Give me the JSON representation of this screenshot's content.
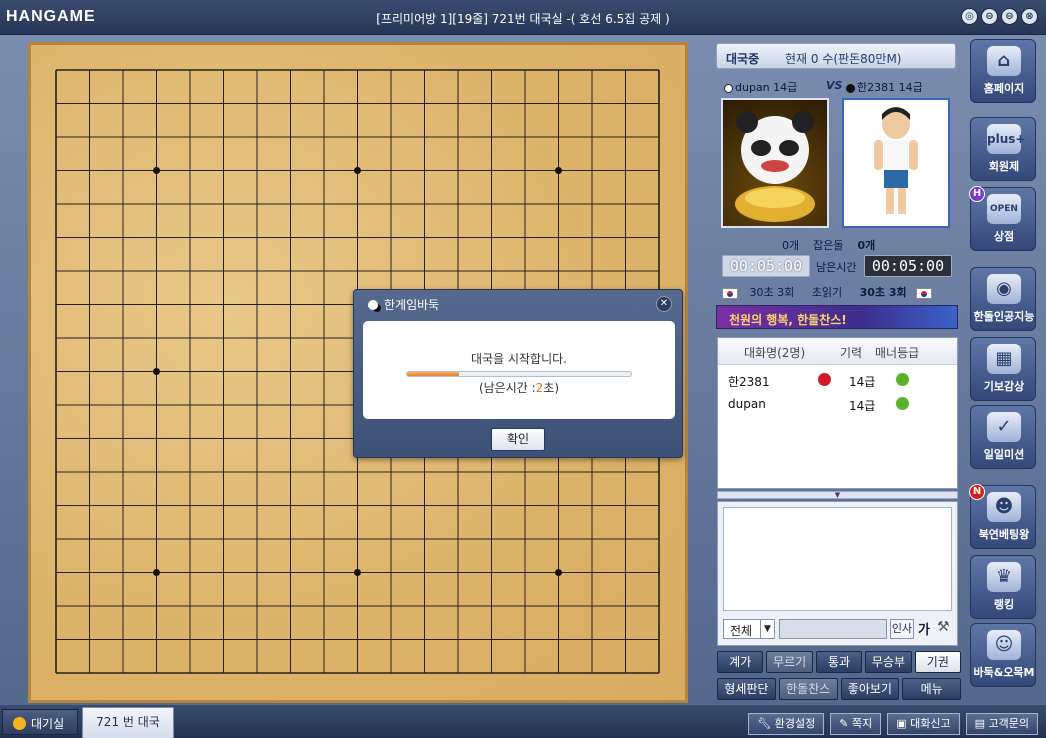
{
  "window": {
    "logo": "HANGAME",
    "title": "[프리미어방 1][19줄] 721번 대국실  -( 호선 6.5집 공제 )",
    "buttons": [
      "◎",
      "⊖",
      "⊖",
      "⊗"
    ]
  },
  "board": {
    "size": 19,
    "hoshi": [
      [
        3,
        3
      ],
      [
        9,
        3
      ],
      [
        15,
        3
      ],
      [
        3,
        9
      ],
      [
        9,
        9
      ],
      [
        15,
        9
      ],
      [
        3,
        15
      ],
      [
        9,
        15
      ],
      [
        15,
        15
      ]
    ]
  },
  "status": {
    "label": "대국중",
    "detail": "현재 0 수(판돈80만M)"
  },
  "players": {
    "white": "dupan 14급",
    "vs": "VS",
    "black": "한2381 14급"
  },
  "captures": {
    "white": "0개",
    "label": "잡은돌",
    "black": "0개"
  },
  "timers": {
    "white": "00:05:00",
    "label": "남은시간",
    "black": "00:05:00"
  },
  "byoyomi": {
    "white": "30초 3회",
    "label": "초읽기",
    "black": "30초 3회"
  },
  "banner": "천원의 행복, 한돌찬스!",
  "userlist": {
    "headers": [
      "대화명(2명)",
      "기력",
      "매너등급"
    ],
    "rows": [
      {
        "name": "한2381",
        "rank": "14급"
      },
      {
        "name": "dupan",
        "rank": "14급"
      }
    ]
  },
  "chat": {
    "scope": "전체",
    "greet": "인사",
    "font": "가"
  },
  "actions1": [
    "계가",
    "무르기",
    "통과",
    "무승부",
    "기권"
  ],
  "actions2": [
    "형세판단",
    "한돌찬스",
    "좋아보기",
    "메뉴"
  ],
  "sidebar": [
    {
      "label": "홈페이지",
      "icon": "⌂"
    },
    {
      "label": "회원제",
      "icon": "plus+"
    },
    {
      "label": "상점",
      "icon": "OPEN"
    },
    {
      "label": "한돌인공지능",
      "icon": "◉"
    },
    {
      "label": "기보감상",
      "icon": "▦"
    },
    {
      "label": "일일미션",
      "icon": "✓"
    },
    {
      "label": "북연베팅왕",
      "icon": "☻"
    },
    {
      "label": "랭킹",
      "icon": "♛"
    },
    {
      "label": "바둑&오목M",
      "icon": "☺"
    }
  ],
  "bottom": {
    "tab_wait": "대기실",
    "tab_game": "721 번 대국",
    "buttons": [
      "환경설정",
      "쪽지",
      "대화신고",
      "고객문의"
    ]
  },
  "dialog": {
    "title": "한게임바둑",
    "message": "대국을 시작합니다.",
    "progress": 0.23,
    "remain_prefix": "(남은시간 :",
    "remain_num": "2",
    "remain_suffix": "초)",
    "ok": "확인",
    "close": "✕"
  },
  "colors": {
    "board": "#ddb36a",
    "accent": "#e67d24",
    "panel": "#52668a"
  }
}
